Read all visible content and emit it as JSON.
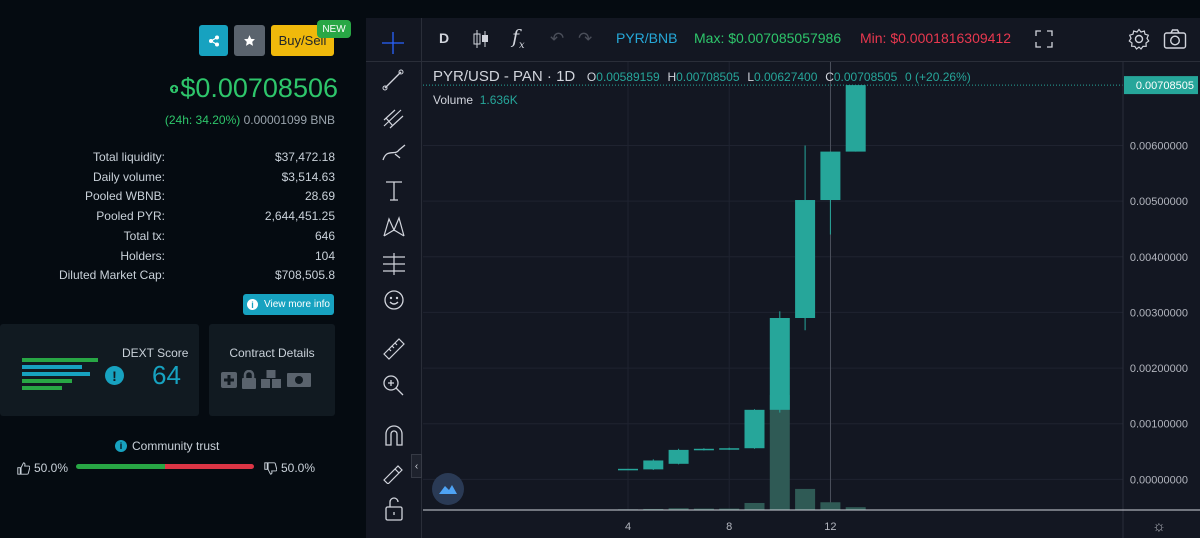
{
  "header": {
    "buy_sell_label": "Buy/Sell",
    "new_badge": "NEW",
    "share_icon": "share-icon",
    "star_icon": "star-icon"
  },
  "price": {
    "value": "$0.00708506",
    "change_pct": "(24h: 34.20%)",
    "bnb_value": "0.00001099 BNB",
    "color": "#2ec66b"
  },
  "stats": [
    {
      "label": "Total liquidity:",
      "value": "$37,472.18"
    },
    {
      "label": "Daily volume:",
      "value": "$3,514.63"
    },
    {
      "label": "Pooled WBNB:",
      "value": "28.69"
    },
    {
      "label": "Pooled PYR:",
      "value": "2,644,451.25"
    },
    {
      "label": "Total tx:",
      "value": "646"
    },
    {
      "label": "Holders:",
      "value": "104"
    },
    {
      "label": "Diluted Market Cap:",
      "value": "$708,505.8"
    }
  ],
  "view_more_label": "View more info",
  "dext": {
    "title": "DEXT Score",
    "score": "64"
  },
  "contract": {
    "title": "Contract Details"
  },
  "trust": {
    "title": "Community trust",
    "up_pct": "50.0%",
    "down_pct": "50.0%",
    "up_fraction": 0.5
  },
  "chart_header": {
    "timeframe": "D",
    "pair": "PYR/BNB",
    "max_label": "Max: $0.007085057986",
    "min_label": "Min: $0.0001816309412"
  },
  "legend": {
    "symbol": "PYR/USD - PAN · 1D",
    "o_key": "O",
    "o_val": "0.00589159",
    "h_key": "H",
    "h_val": "0.00708505",
    "l_key": "L",
    "l_val": "0.00627400",
    "c_key": "C",
    "c_val": "0.00708505",
    "change": "0 (+20.26%)",
    "volume_label": "Volume",
    "volume_val": "1.636K"
  },
  "chart_data": {
    "type": "candlestick",
    "x_ticks": [
      "4",
      "8",
      "12"
    ],
    "y_ticks": [
      "0.00600000",
      "0.00500000",
      "0.00400000",
      "0.00300000",
      "0.00200000",
      "0.00100000",
      "0.00000000"
    ],
    "y_tick_values": [
      0.006,
      0.005,
      0.004,
      0.003,
      0.002,
      0.001,
      0.0
    ],
    "ylim": [
      -0.00055,
      0.0075
    ],
    "last_price_label": "0.00708505",
    "last_price": 0.00708505,
    "colors": {
      "up": "#26a69a",
      "volume": "#2f5a55",
      "last": "#26a69a"
    },
    "candles": [
      {
        "x": 4,
        "o": 0.00018,
        "h": 0.00019,
        "l": 0.00017,
        "c": 0.00019
      },
      {
        "x": 5,
        "o": 0.00018,
        "h": 0.00036,
        "l": 0.00017,
        "c": 0.00034
      },
      {
        "x": 6,
        "o": 0.00028,
        "h": 0.00055,
        "l": 0.00027,
        "c": 0.00053
      },
      {
        "x": 7,
        "o": 0.00053,
        "h": 0.00056,
        "l": 0.00052,
        "c": 0.00055
      },
      {
        "x": 8,
        "o": 0.00054,
        "h": 0.00057,
        "l": 0.00053,
        "c": 0.00056
      },
      {
        "x": 9,
        "o": 0.00056,
        "h": 0.00126,
        "l": 0.00055,
        "c": 0.00125
      },
      {
        "x": 10,
        "o": 0.00125,
        "h": 0.00302,
        "l": 0.0012,
        "c": 0.0029
      },
      {
        "x": 11,
        "o": 0.0029,
        "h": 0.006,
        "l": 0.00268,
        "c": 0.00502
      },
      {
        "x": 12,
        "o": 0.00502,
        "h": 0.00588,
        "l": 0.0044,
        "c": 0.00589
      },
      {
        "x": 13,
        "o": 0.00589,
        "h": 0.00708505,
        "l": 0.00627,
        "c": 0.00708505
      }
    ],
    "volumes": [
      {
        "x": 4,
        "v": 10
      },
      {
        "x": 5,
        "v": 15
      },
      {
        "x": 6,
        "v": 25
      },
      {
        "x": 7,
        "v": 20
      },
      {
        "x": 8,
        "v": 20
      },
      {
        "x": 9,
        "v": 100
      },
      {
        "x": 10,
        "v": 1636
      },
      {
        "x": 11,
        "v": 300
      },
      {
        "x": 12,
        "v": 110
      },
      {
        "x": 13,
        "v": 40
      }
    ],
    "volume_max": 1636
  }
}
